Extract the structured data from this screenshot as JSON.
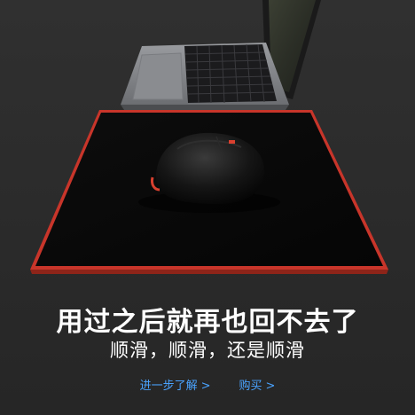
{
  "headline": "用过之后就再也回不去了",
  "subline": "顺滑，顺滑，还是顺滑",
  "links": {
    "learn_more": "进一步了解",
    "buy": "购买",
    "chevron": ">"
  },
  "colors": {
    "background": "#2a2a2a",
    "pad_surface": "#070707",
    "pad_edge": "#d93a2b",
    "link": "#4aa3ff"
  },
  "icons": [
    "laptop-image",
    "mouse-image",
    "mousepad-image"
  ]
}
